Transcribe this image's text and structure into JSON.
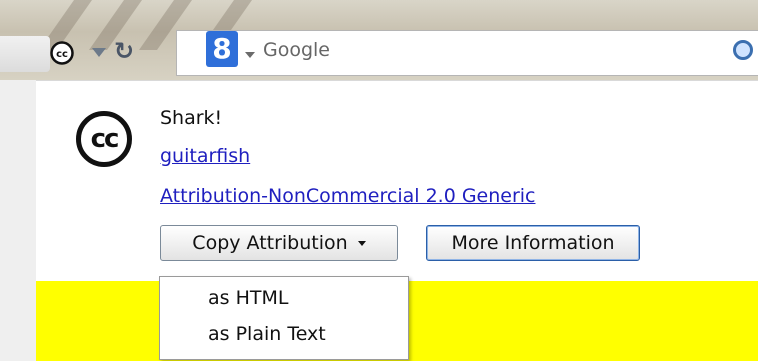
{
  "toolbar": {
    "search_engine_name": "Google",
    "icons": [
      "cc-icon",
      "dropdown-arrow-icon",
      "reload-icon",
      "google-icon",
      "search-icon"
    ]
  },
  "attribution": {
    "work_title": "Shark!",
    "author": "guitarfish",
    "license": "Attribution-NonCommercial 2.0 Generic",
    "copy_button_label": "Copy Attribution",
    "more_info_button_label": "More Information"
  },
  "copy_menu": {
    "items": [
      "as HTML",
      "as Plain Text"
    ]
  },
  "colors": {
    "link": "#1f1fbf",
    "highlight": "#ffff00",
    "google_blue": "#2f6fd9"
  }
}
